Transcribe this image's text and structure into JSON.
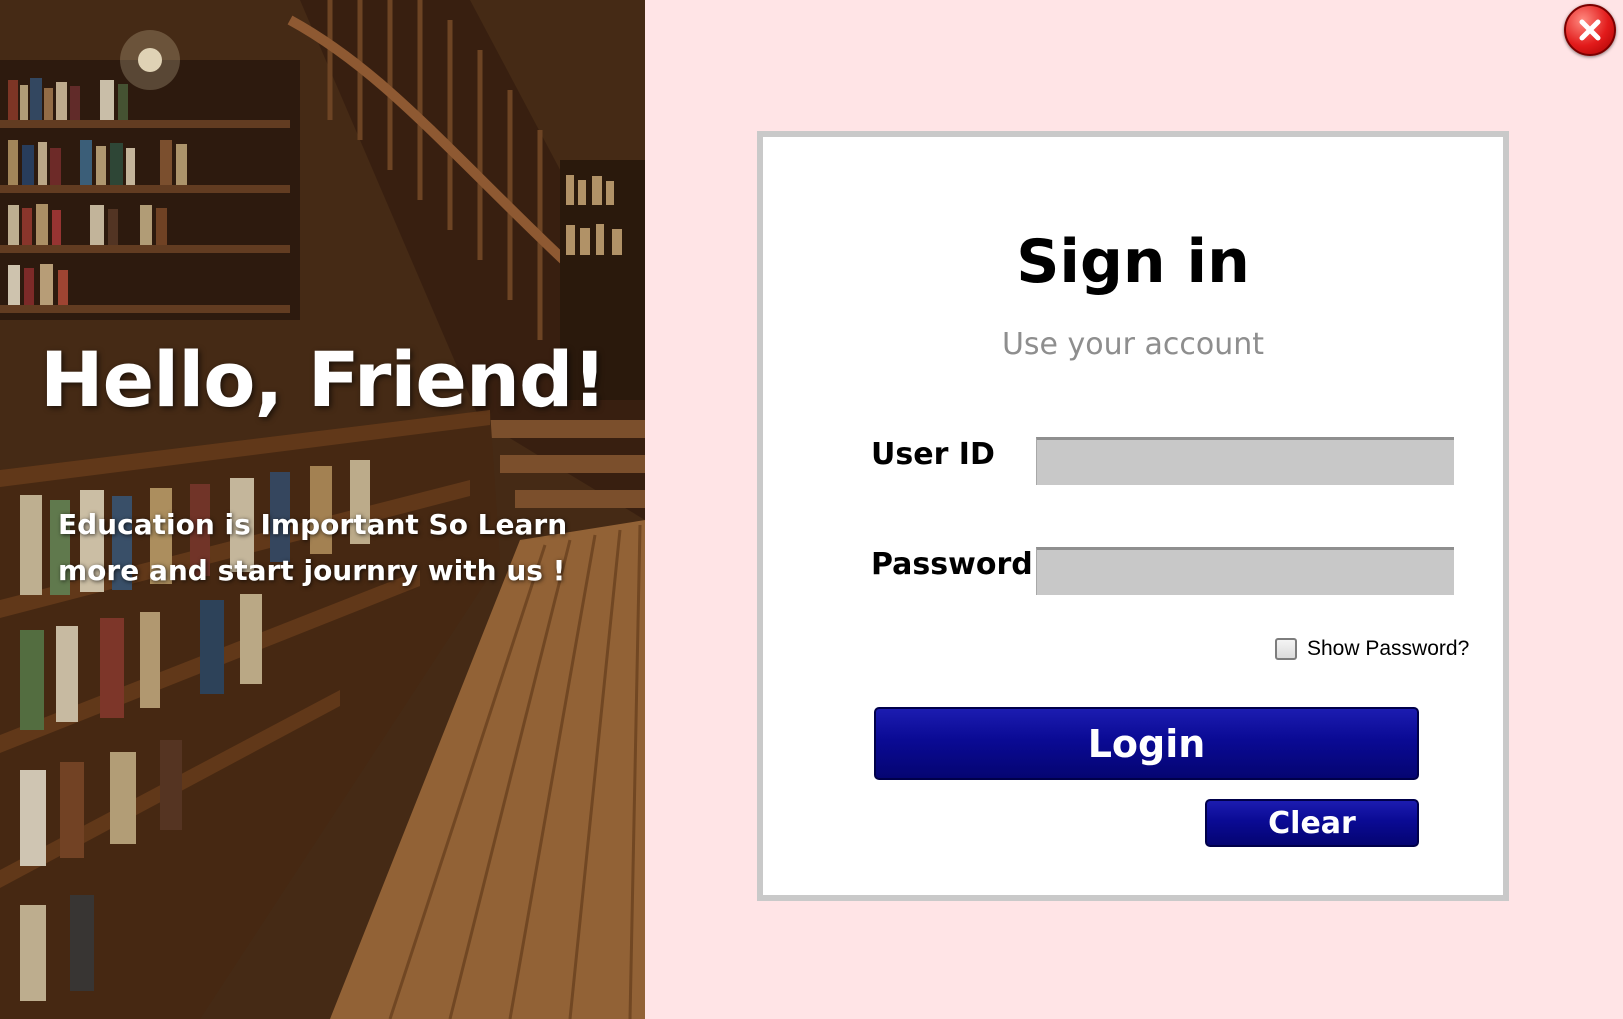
{
  "left": {
    "heading": "Hello, Friend!",
    "tagline_line1": "Education is Important So Learn",
    "tagline_line2": "more and start journry with us !",
    "background_image": "bookstore-library-photo-icon"
  },
  "window": {
    "close_icon": "close-icon"
  },
  "form": {
    "title": "Sign in",
    "subtitle": "Use your account",
    "user_id_label": "User ID",
    "user_id_value": "",
    "password_label": "Password",
    "password_value": "",
    "show_password_label": "Show Password?",
    "show_password_checked": false,
    "login_label": "Login",
    "clear_label": "Clear"
  },
  "colors": {
    "right_bg": "#ffe4e6",
    "button_blue": "#0a0a94",
    "input_gray": "#c8c8c8",
    "close_red": "#e21b1b"
  }
}
